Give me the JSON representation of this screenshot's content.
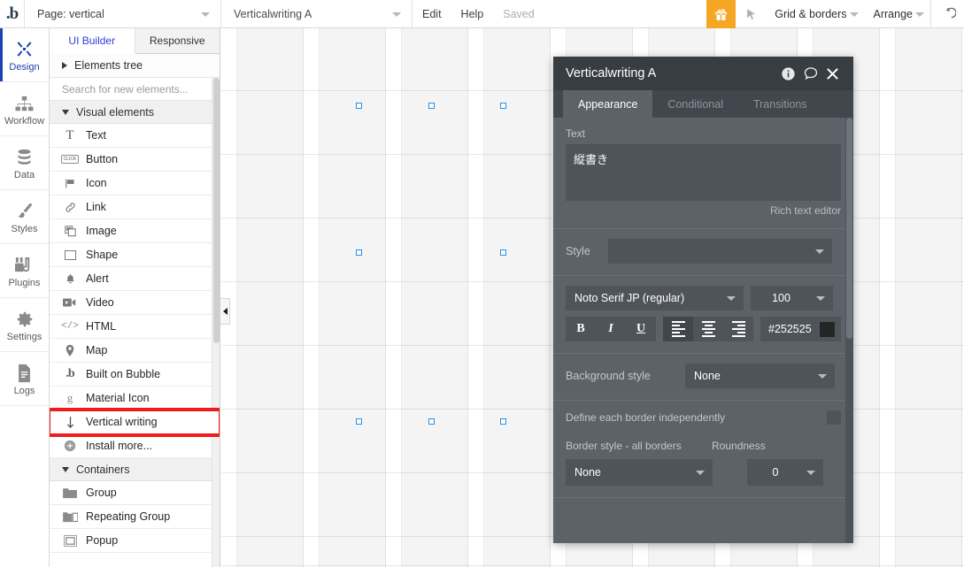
{
  "topbar": {
    "logo": ".b",
    "page_selector": "Page: vertical",
    "element_selector": "Verticalwriting A",
    "edit": "Edit",
    "help": "Help",
    "save_status": "Saved",
    "gift_icon": "gift-icon",
    "cursor_icon": "cursor-icon",
    "grid_borders": "Grid & borders",
    "arrange": "Arrange",
    "undo_icon": "undo-icon"
  },
  "rail": {
    "items": [
      {
        "label": "Design",
        "icon": "design-icon",
        "active": true
      },
      {
        "label": "Workflow",
        "icon": "workflow-icon",
        "active": false
      },
      {
        "label": "Data",
        "icon": "database-icon",
        "active": false
      },
      {
        "label": "Styles",
        "icon": "paintbrush-icon",
        "active": false
      },
      {
        "label": "Plugins",
        "icon": "plug-icon",
        "active": false
      },
      {
        "label": "Settings",
        "icon": "gear-icon",
        "active": false
      },
      {
        "label": "Logs",
        "icon": "document-icon",
        "active": false
      }
    ]
  },
  "panel": {
    "tabs": [
      {
        "label": "UI Builder",
        "active": true
      },
      {
        "label": "Responsive",
        "active": false
      }
    ],
    "elements_tree": "Elements tree",
    "search_placeholder": "Search for new elements...",
    "groups": [
      {
        "title": "Visual elements",
        "items": [
          {
            "label": "Text",
            "icon": "text-icon"
          },
          {
            "label": "Button",
            "icon": "button-icon"
          },
          {
            "label": "Icon",
            "icon": "flag-icon"
          },
          {
            "label": "Link",
            "icon": "link-icon"
          },
          {
            "label": "Image",
            "icon": "image-icon"
          },
          {
            "label": "Shape",
            "icon": "shape-icon"
          },
          {
            "label": "Alert",
            "icon": "bell-icon"
          },
          {
            "label": "Video",
            "icon": "video-icon"
          },
          {
            "label": "HTML",
            "icon": "code-icon"
          },
          {
            "label": "Map",
            "icon": "map-pin-icon"
          },
          {
            "label": "Built on Bubble",
            "icon": "bubble-icon"
          },
          {
            "label": "Material Icon",
            "icon": "material-icon"
          },
          {
            "label": "Vertical writing",
            "icon": "down-arrow-icon",
            "highlighted": true
          },
          {
            "label": "Install more...",
            "icon": "plus-circle-icon"
          }
        ]
      },
      {
        "title": "Containers",
        "items": [
          {
            "label": "Group",
            "icon": "folder-icon"
          },
          {
            "label": "Repeating Group",
            "icon": "repeating-group-icon"
          },
          {
            "label": "Popup",
            "icon": "popup-icon"
          }
        ]
      }
    ]
  },
  "canvas": {
    "selected_element_text": "縦書き"
  },
  "property_editor": {
    "title": "Verticalwriting A",
    "header_icons": [
      "info-icon",
      "comment-icon",
      "close-icon"
    ],
    "tabs": [
      {
        "label": "Appearance",
        "active": true
      },
      {
        "label": "Conditional",
        "active": false
      },
      {
        "label": "Transitions",
        "active": false
      }
    ],
    "text_label": "Text",
    "text_value": "縦書き",
    "rich_text_editor": "Rich text editor",
    "style_label": "Style",
    "style_value": "",
    "font_family": "Noto Serif JP (regular)",
    "font_size": "100",
    "bold": "B",
    "italic": "I",
    "underline": "U",
    "align_left_icon": "align-left-icon",
    "align_center_icon": "align-center-icon",
    "align_right_icon": "align-right-icon",
    "font_color": "#252525",
    "background_style_label": "Background style",
    "background_style_value": "None",
    "define_borders_label": "Define each border independently",
    "border_style_label": "Border style - all borders",
    "border_style_value": "None",
    "roundness_label": "Roundness",
    "roundness_value": "0"
  },
  "colors": {
    "accent_blue": "#1b42b3",
    "selection_blue": "#2b8fe0",
    "highlight_red": "#ee1c1c",
    "gift_orange": "#f5a623",
    "panel_bg": "#5d6268",
    "panel_header": "#383d42"
  }
}
